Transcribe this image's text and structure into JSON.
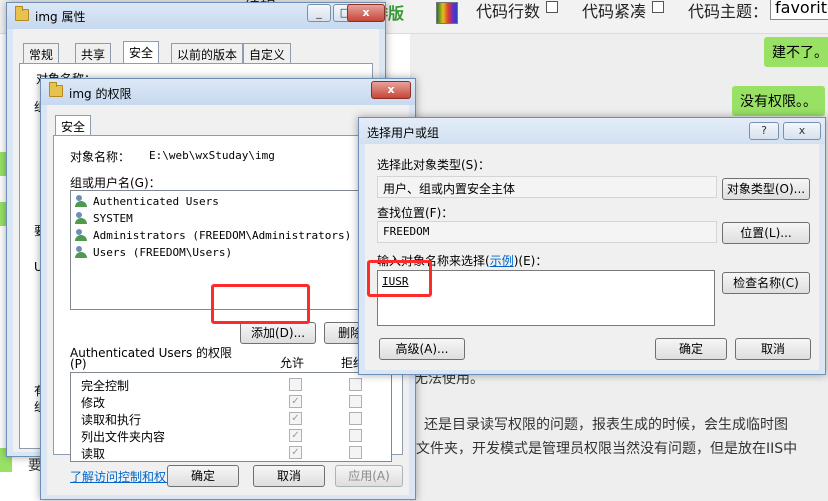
{
  "background": {
    "toolbar": {
      "left_text": "编辑",
      "brand": "编排版",
      "line_numbers": "代码行数",
      "compact": "代码紧凑",
      "theme_label": "代码主题：",
      "theme_value": "favorite"
    },
    "chat": {
      "bubble_1": "建不了。",
      "bubble_2": "没有权限。。",
      "line_1": "还是目录读写权限的问题，报表生成的时候，会生成临时图",
      "line_2": "文件夹，开发模式是管理员权限当然没有问题，但是放在IIS中",
      "line_3": "无法使用。",
      "left_snip_1": "要"
    }
  },
  "props_window": {
    "title": "img 属性",
    "tabs": [
      "常规",
      "共享",
      "安全",
      "以前的版本",
      "自定义"
    ],
    "active_tab": "安全",
    "object_label_partial": "对象名称：",
    "side_snips": [
      "组",
      "要",
      "U",
      "有",
      "组"
    ]
  },
  "perm_window": {
    "title": "img 的权限",
    "tab": "安全",
    "object_label": "对象名称：",
    "object_value": "E:\\web\\wxStuday\\img",
    "group_label": "组或用户名(G)：",
    "users": [
      "Authenticated Users",
      "SYSTEM",
      "Administrators (FREEDOM\\Administrators)",
      "Users (FREEDOM\\Users)"
    ],
    "add_button": "添加(D)...",
    "remove_button": "删除(R)",
    "perm_header": "Authenticated Users 的权限",
    "perm_header_p": "(P)",
    "allow_col": "允许",
    "deny_col": "拒绝",
    "permissions": [
      "完全控制",
      "修改",
      "读取和执行",
      "列出文件夹内容",
      "读取"
    ],
    "learn_link": "了解访问控制和权限",
    "ok_button": "确定",
    "cancel_button": "取消",
    "apply_button": "应用(A)"
  },
  "select_window": {
    "title": "选择用户或组",
    "help_button": "?",
    "close_button": "x",
    "object_type_label": "选择此对象类型(S)：",
    "object_type_value": "用户、组或内置安全主体",
    "object_type_button": "对象类型(O)...",
    "location_label": "查找位置(F)：",
    "location_value": "FREEDOM",
    "location_button": "位置(L)...",
    "enter_label_pre": "输入对象名称来选择(",
    "enter_label_link": "示例",
    "enter_label_post": ")(E)：",
    "entered_name": "IUSR",
    "check_button": "检查名称(C)",
    "advanced_button": "高级(A)...",
    "ok_button": "确定",
    "cancel_button": "取消"
  },
  "colors": {
    "highlight": "#ff2a2a",
    "chat_bubble": "#98e165",
    "link": "#0066cc"
  }
}
